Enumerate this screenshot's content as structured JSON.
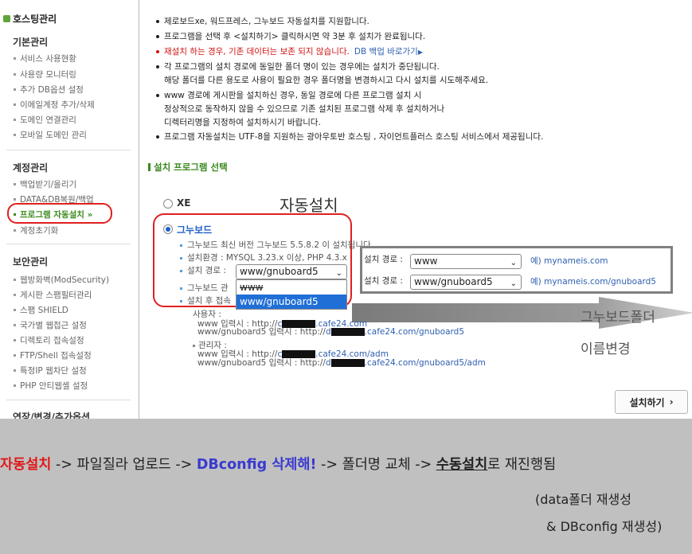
{
  "sidebar": {
    "title": "호스팅관리",
    "groups": [
      {
        "label": "기본관리",
        "items": [
          "서비스 사용현황",
          "사용량 모니터링",
          "추가 DB옵션 설정",
          "이메일계정 추가/삭제",
          "도메인 연결관리",
          "모바일 도메인 관리"
        ]
      },
      {
        "label": "계정관리",
        "items": [
          "백업받기/올리기",
          "DATA&DB복원/백업",
          "프로그램 자동설치",
          "계정초기화"
        ]
      },
      {
        "label": "보안관리",
        "items": [
          "웹방화벽(ModSecurity)",
          "게시판 스팸필터관리",
          "스팸 SHIELD",
          "국가별 웹접근 설정",
          "디렉토리 접속설정",
          "FTP/Shell 접속설정",
          "특정IP 웹차단 설정",
          "PHP 안티웹셸 설정"
        ]
      },
      {
        "label": "연장/변경/추가옵션"
      }
    ],
    "active_mark": "»"
  },
  "notes": [
    "제로보드xe, 워드프레스, 그누보드 자동설치를 지원합니다.",
    "프로그램을 선택 후 <설치하기> 클릭하시면 약 3분 후 설치가 완료됩니다.",
    "재설치 하는 경우, 기존 데이터는 보존 되지 않습니다.",
    "각 프로그램의 설치 경로에 동일한 폴더 명이 있는 경우에는 설치가 중단됩니다.",
    "해당 폴더를 다른 용도로 사용이 필요한 경우 폴더명을 변경하시고 다시 설치를 시도해주세요.",
    "www 경로에 게시판을 설치하신 경우, 동일 경로에 다른 프로그램 설치 시",
    "정상적으로 동작하지 않을 수 있으므로 기존 설치된 프로그램 삭제 후 설치하거나",
    "디렉터리명을 지정하여 설치하시기 바랍니다.",
    "프로그램 자동설치는 UTF-8을 지원하는 광아우토반 호스팅 , 자이언트플러스 호스팅 서비스에서 제공됩니다."
  ],
  "db_link": "DB 백업 바로가기",
  "section_title": "설치 프로그램 선택",
  "auto_label": "자동설치",
  "radio_xe": "XE",
  "radio_gnu": "그누보드",
  "gnu_lines": {
    "version": "그누보드 최신 버전 그누보드 5.5.8.2 이 설치됩니다.",
    "env": "설치환경 : MYSQL 3.23.x 이상, PHP 4.3.x",
    "path_label": "설치 경로 :",
    "admin": "그누보드 관",
    "after": "설치 후 접속"
  },
  "path_select": {
    "value": "www/gnuboard5",
    "options": [
      "www",
      "www/gnuboard5"
    ]
  },
  "gray_box": {
    "rows": [
      {
        "label": "설치 경로 :",
        "value": "www",
        "example": "예) mynameis.com"
      },
      {
        "label": "설치 경로 :",
        "value": "www/gnuboard5",
        "example": "예) mynameis.com/gnuboard5"
      }
    ]
  },
  "side_note_1": "그누보드폴더",
  "side_note_2": "이름변경",
  "user_section": {
    "user_title": "사용자 :",
    "user_www_prefix": "www 입력시 : http://",
    "user_www_suffix": ".cafe24.com",
    "user_gnu_prefix": "www/gnuboard5 입력시 : http://",
    "user_gnu_suffix": ".cafe24.com/gnuboard5",
    "admin_title": "관리자 :",
    "admin_www_prefix": "www 입력시 : http://",
    "admin_www_suffix": ".cafe24.com/adm",
    "admin_gnu_prefix": "www/gnuboard5 입력시 : http://",
    "admin_gnu_suffix": ".cafe24.com/gnuboard5/adm",
    "mask_c": "c",
    "mask_d": "d"
  },
  "install_button": "설치하기",
  "install_chevron": "›",
  "banner": {
    "step1": "자동설치",
    "sep1": " -> 파일질라 업로드 -> ",
    "step2": "DBconfig 삭제해!",
    "sep2": " -> 폴더명 교체 -> ",
    "step3": "수동설치",
    "tail": "로 재진행됨",
    "sub1": "(data폴더 재생성",
    "sub2": "& DBconfig 재생성)"
  },
  "colors": {
    "accent_green": "#3a8a1e",
    "alert_red": "#e02020",
    "link_blue": "#3060b0",
    "banner_gray": "#c0c0c0"
  }
}
